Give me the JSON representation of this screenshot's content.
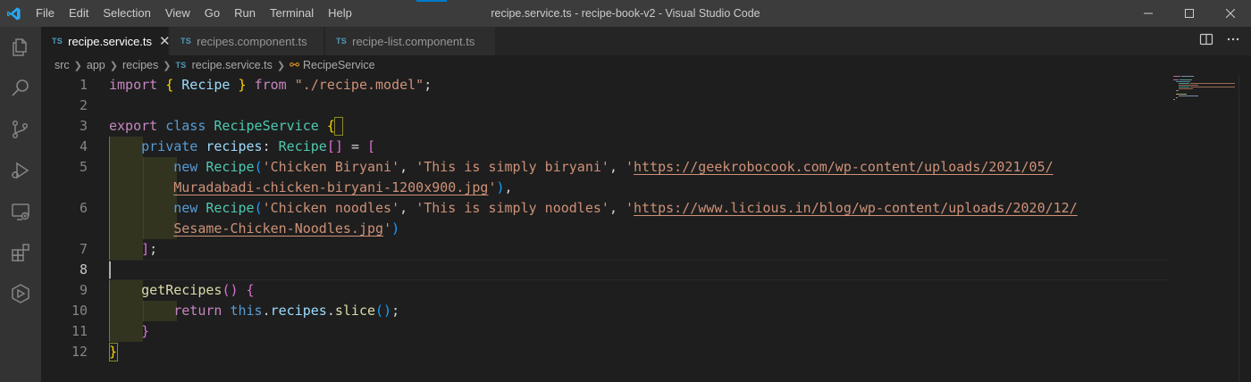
{
  "titlebar": {
    "title": "recipe.service.ts - recipe-book-v2 - Visual Studio Code",
    "menu": [
      "File",
      "Edit",
      "Selection",
      "View",
      "Go",
      "Run",
      "Terminal",
      "Help"
    ]
  },
  "tabs": [
    {
      "badge": "TS",
      "label": "recipe.service.ts",
      "active": true
    },
    {
      "badge": "TS",
      "label": "recipes.component.ts",
      "active": false
    },
    {
      "badge": "TS",
      "label": "recipe-list.component.ts",
      "active": false
    }
  ],
  "breadcrumb": {
    "parts": [
      "src",
      "app",
      "recipes"
    ],
    "file_badge": "TS",
    "file": "recipe.service.ts",
    "symbol": "RecipeService"
  },
  "editor": {
    "line_numbers": [
      "1",
      "2",
      "3",
      "4",
      "5",
      "",
      "6",
      "",
      "7",
      "8",
      "9",
      "10",
      "11",
      "12"
    ],
    "current_line": "8",
    "code": {
      "l1": {
        "import": "import",
        "ob": "{",
        "recipe": "Recipe",
        "cb": "}",
        "from": "from",
        "path": "\"./recipe.model\"",
        "semi": ";"
      },
      "l3": {
        "export": "export",
        "class": "class",
        "name": "RecipeService",
        "ob": "{"
      },
      "l4": {
        "private": "private",
        "prop": "recipes",
        "colon": ":",
        "type": "Recipe",
        "arr": "[]",
        "eq": "=",
        "ob": "["
      },
      "l5": {
        "new": "new",
        "cls": "Recipe",
        "op": "(",
        "s1": "'Chicken Biryani'",
        "c1": ",",
        "s2": "'This is simply biryani'",
        "c2": ",",
        "q": "'",
        "url1": "https://geekrobocook.com/wp-content/uploads/2021/05/"
      },
      "l5b": {
        "url2": "Muradabadi-chicken-biryani-1200x900.jpg",
        "q": "'",
        "cp": ")",
        "comma": ","
      },
      "l6": {
        "new": "new",
        "cls": "Recipe",
        "op": "(",
        "s1": "'Chicken noodles'",
        "c1": ",",
        "s2": "'This is simply noodles'",
        "c2": ",",
        "q": "'",
        "url1": "https://www.licious.in/blog/wp-content/uploads/2020/12/"
      },
      "l6b": {
        "url2": "Sesame-Chicken-Noodles.jpg",
        "q": "'",
        "cp": ")"
      },
      "l7": {
        "cb": "]",
        "semi": ";"
      },
      "l9": {
        "fn": "getRecipes",
        "parens": "()",
        "ob": "{"
      },
      "l10": {
        "ret": "return",
        "this": "this",
        "dot1": ".",
        "prop": "recipes",
        "dot2": ".",
        "fn": "slice",
        "parens": "()",
        "semi": ";"
      },
      "l11": {
        "cb": "}"
      },
      "l12": {
        "cb": "}"
      }
    }
  },
  "colors": {
    "accent": "#007acc",
    "keyword_control": "#c586c0",
    "keyword": "#569cd6",
    "class": "#4ec9b0",
    "variable": "#9cdcfe",
    "function": "#dcdcaa",
    "string": "#ce9178"
  }
}
